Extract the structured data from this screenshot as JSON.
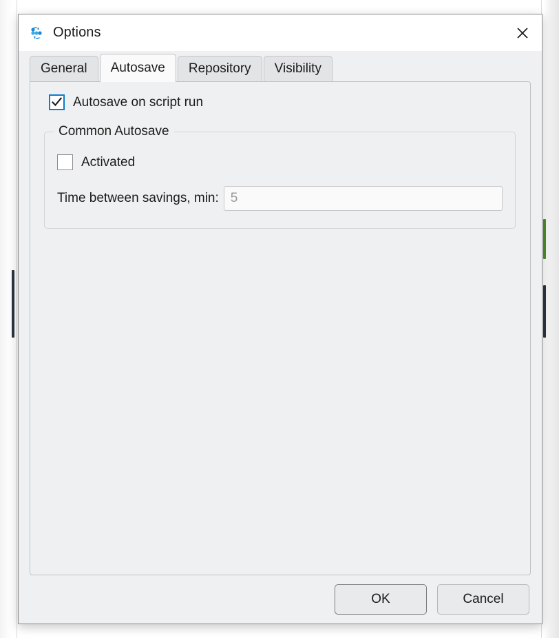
{
  "window": {
    "title": "Options",
    "icon": "sync-dots-icon",
    "close_label": "✕",
    "accent_blue": "#1a87d8",
    "background": "#eff0f1",
    "titlebar_background": "#ffffff"
  },
  "tabs": [
    {
      "label": "General",
      "active": false
    },
    {
      "label": "Autosave",
      "active": true
    },
    {
      "label": "Repository",
      "active": false
    },
    {
      "label": "Visibility",
      "active": false
    }
  ],
  "panel": {
    "autosave_on_script_run": {
      "label": "Autosave on script run",
      "checked": true,
      "checkbox_border_color": "#0a7cd1"
    },
    "group": {
      "title": "Common Autosave",
      "activated": {
        "label": "Activated",
        "checked": false,
        "checkbox_border_color": "#8d8d8d"
      },
      "time_between_savings": {
        "label": "Time between savings, min:",
        "value": "5",
        "placeholder": "5",
        "enabled": false
      }
    }
  },
  "footer": {
    "ok_label": "OK",
    "cancel_label": "Cancel"
  }
}
